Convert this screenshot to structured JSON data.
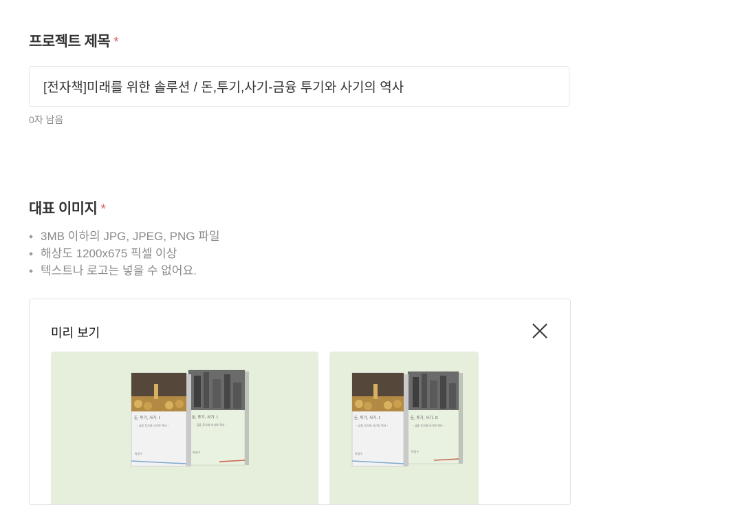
{
  "project_title": {
    "label": "프로젝트 제목",
    "required_mark": "*",
    "value": "[전자책]미래를 위한 솔루션 / 돈,투기,사기-금융 투기와 사기의 역사",
    "counter": "0자 남음"
  },
  "cover_image": {
    "label": "대표 이미지",
    "required_mark": "*",
    "guidelines": [
      "3MB 이하의 JPG, JPEG, PNG 파일",
      "해상도 1200x675 픽셀 이상",
      "텍스트나 로고는 넣을 수 없어요."
    ]
  },
  "preview": {
    "label": "미리 보기",
    "close_icon": "close-icon",
    "background_color": "#e6efdc",
    "book_left": {
      "title": "돈, 투기, 사기. Ⅰ",
      "subtitle": "- 금융 투기와 사기의 역사 -",
      "author": "박경수"
    },
    "book_right": {
      "title": "돈, 투기, 사기. Ⅰ",
      "subtitle": "- 금융 투기와 사기의 역사 -",
      "author": "박경수"
    },
    "book_left_small": {
      "title": "돈, 투기, 사기. Ⅰ",
      "subtitle": "- 금융 투기와 사기의 역사 -",
      "author": "박경수"
    },
    "book_right_small": {
      "title": "돈, 투기, 사기. Ⅱ",
      "subtitle": "- 금융 투기와 사기의 역사 -",
      "author": "박경수"
    }
  },
  "colors": {
    "required": "#e0585a",
    "muted": "#8a8a8a",
    "preview_bg": "#e6efdc"
  }
}
